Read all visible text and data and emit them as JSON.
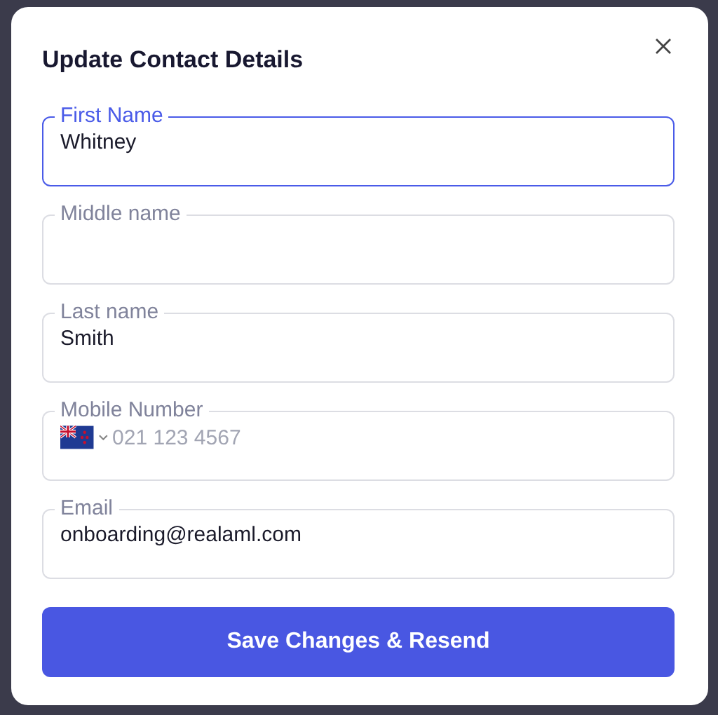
{
  "dialog": {
    "title": "Update Contact Details",
    "fields": [
      {
        "kind": "text",
        "label": "First Name",
        "value": "Whitney",
        "focused": true
      },
      {
        "kind": "text",
        "label": "Middle name",
        "focused": false
      },
      {
        "kind": "text",
        "label": "Last name",
        "value": "Smith",
        "focused": false
      },
      {
        "kind": "phone",
        "label": "Mobile Number",
        "placeholder": "021 123 4567",
        "focused": false
      },
      {
        "kind": "text",
        "label": "Email",
        "value": "onboarding@realaml.com",
        "focused": false
      }
    ],
    "submit": "Save Changes & Resend"
  }
}
